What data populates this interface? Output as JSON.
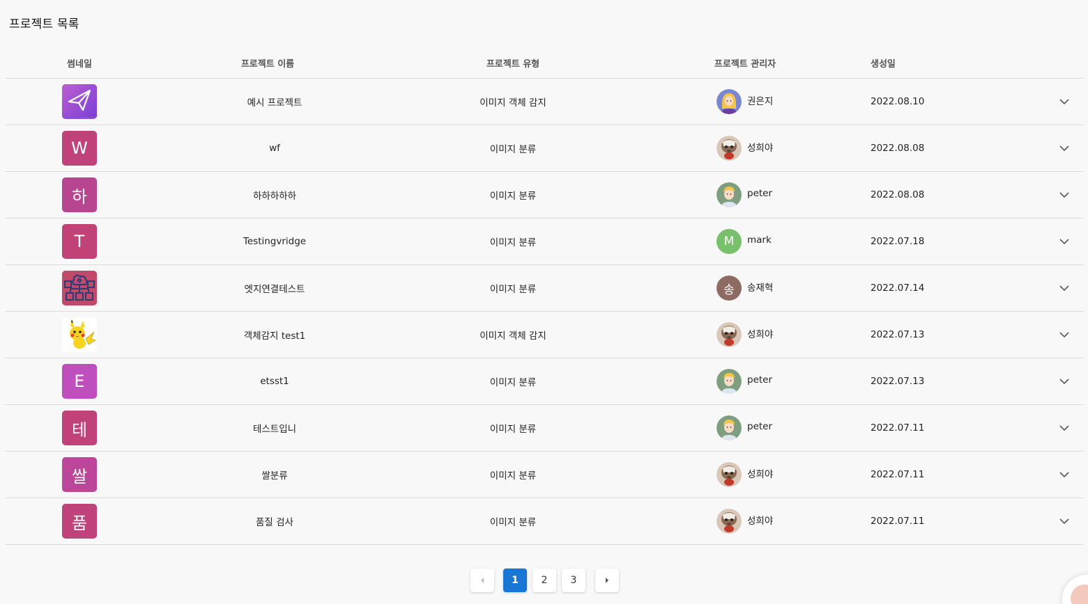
{
  "page_title": "프로젝트 목록",
  "columns": {
    "thumbnail": "썸네일",
    "name": "프로젝트 이름",
    "type": "프로젝트 유형",
    "manager": "프로젝트 관리자",
    "created": "생성일"
  },
  "rows": [
    {
      "thumb": {
        "kind": "icon",
        "icon": "paper-plane-icon",
        "color": "#8e4ecf"
      },
      "name": "예시 프로젝트",
      "type": "이미지 객체 감지",
      "manager": {
        "name": "권은지",
        "avatar": "woman-avatar"
      },
      "created": "2022.08.10"
    },
    {
      "thumb": {
        "kind": "letter",
        "letter": "W",
        "color": "#c0427a"
      },
      "name": "wf",
      "type": "이미지 분류",
      "manager": {
        "name": "성희야",
        "avatar": "cat-photo-avatar"
      },
      "created": "2022.08.08"
    },
    {
      "thumb": {
        "kind": "letter",
        "letter": "하",
        "color": "#b8458f"
      },
      "name": "하하하하하",
      "type": "이미지 분류",
      "manager": {
        "name": "peter",
        "avatar": "man-avatar"
      },
      "created": "2022.08.08"
    },
    {
      "thumb": {
        "kind": "letter",
        "letter": "T",
        "color": "#c04277"
      },
      "name": "Testingvridge",
      "type": "이미지 분류",
      "manager": {
        "name": "mark",
        "avatar": "letter-avatar",
        "letter": "M",
        "color": "#79c06c"
      },
      "created": "2022.07.18"
    },
    {
      "thumb": {
        "kind": "icon",
        "icon": "cloud-network-icon",
        "color": "#c04a6a"
      },
      "name": "엣지연결테스트",
      "type": "이미지 분류",
      "manager": {
        "name": "송재혁",
        "avatar": "letter-avatar",
        "letter": "송",
        "color": "#8d6b63"
      },
      "created": "2022.07.14"
    },
    {
      "thumb": {
        "kind": "icon",
        "icon": "pikachu-icon",
        "color": "#ffffff"
      },
      "name": "객체감지 test1",
      "type": "이미지 객체 감지",
      "manager": {
        "name": "성희야",
        "avatar": "cat-photo-avatar"
      },
      "created": "2022.07.13"
    },
    {
      "thumb": {
        "kind": "letter",
        "letter": "E",
        "color": "#c04fbe"
      },
      "name": "etsst1",
      "type": "이미지 분류",
      "manager": {
        "name": "peter",
        "avatar": "man-avatar"
      },
      "created": "2022.07.13"
    },
    {
      "thumb": {
        "kind": "letter",
        "letter": "테",
        "color": "#c04278"
      },
      "name": "테스트입니",
      "type": "이미지 분류",
      "manager": {
        "name": "peter",
        "avatar": "man-avatar"
      },
      "created": "2022.07.11"
    },
    {
      "thumb": {
        "kind": "letter",
        "letter": "쌀",
        "color": "#bc479a"
      },
      "name": "쌀분류",
      "type": "이미지 분류",
      "manager": {
        "name": "성희야",
        "avatar": "cat-photo-avatar"
      },
      "created": "2022.07.11"
    },
    {
      "thumb": {
        "kind": "letter",
        "letter": "품",
        "color": "#c0427a"
      },
      "name": "품질 검사",
      "type": "이미지 분류",
      "manager": {
        "name": "성희야",
        "avatar": "cat-photo-avatar"
      },
      "created": "2022.07.11"
    }
  ],
  "pagination": {
    "pages": [
      "1",
      "2",
      "3"
    ],
    "current": "1",
    "accent": "#1976d2"
  }
}
